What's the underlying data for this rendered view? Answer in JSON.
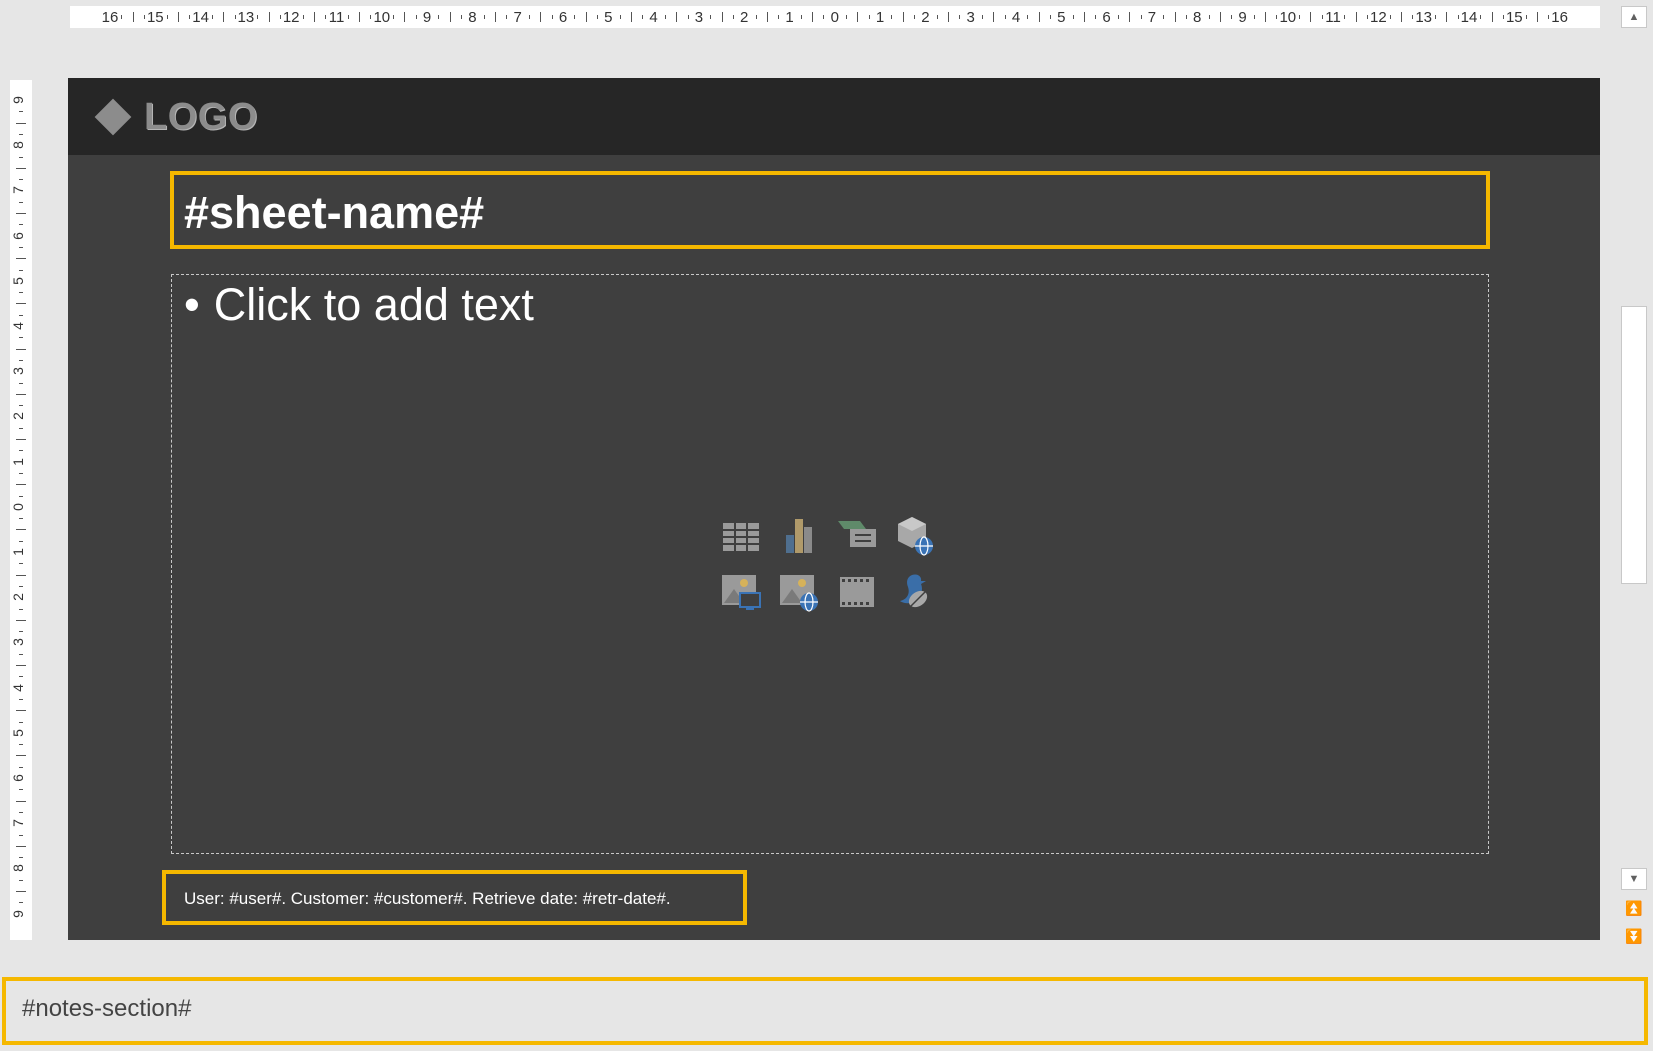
{
  "ruler": {
    "horizontal_labels": [
      "16",
      "15",
      "14",
      "13",
      "12",
      "11",
      "10",
      "9",
      "8",
      "7",
      "6",
      "5",
      "4",
      "3",
      "2",
      "1",
      "0",
      "1",
      "2",
      "3",
      "4",
      "5",
      "6",
      "7",
      "8",
      "9",
      "10",
      "11",
      "12",
      "13",
      "14",
      "15",
      "16"
    ],
    "vertical_labels": [
      "9",
      "8",
      "7",
      "6",
      "5",
      "4",
      "3",
      "2",
      "1",
      "0",
      "1",
      "2",
      "3",
      "4",
      "5",
      "6",
      "7",
      "8",
      "9"
    ]
  },
  "slide": {
    "logo_text": "LOGO",
    "title": "#sheet-name#",
    "bullet": "•",
    "content_placeholder": "Click to add text",
    "footer": "User: #user#. Customer: #customer#. Retrieve date: #retr-date#.",
    "content_icons": [
      "insert-table-icon",
      "insert-chart-icon",
      "insert-smartart-icon",
      "insert-3d-model-icon",
      "insert-picture-icon",
      "insert-online-picture-icon",
      "insert-video-icon",
      "insert-icons-icon"
    ]
  },
  "notes": {
    "text": "#notes-section#"
  },
  "colors": {
    "highlight_border": "#f5b800",
    "slide_background": "#3f3f3f",
    "header_background": "#262626"
  }
}
